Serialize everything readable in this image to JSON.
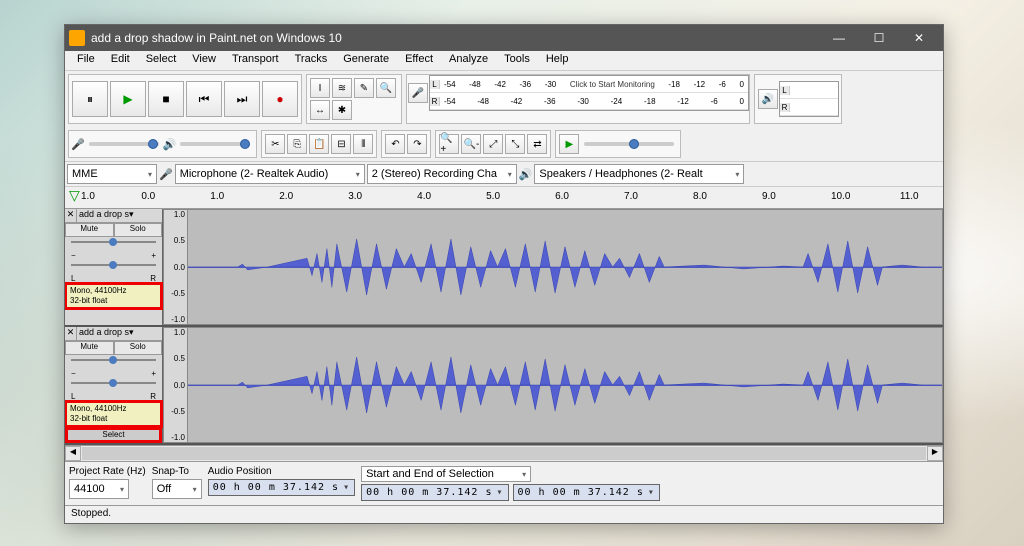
{
  "window": {
    "title": "add a drop shadow in Paint.net on Windows 10"
  },
  "menu": [
    "File",
    "Edit",
    "Select",
    "View",
    "Transport",
    "Tracks",
    "Generate",
    "Effect",
    "Analyze",
    "Tools",
    "Help"
  ],
  "meters": {
    "monitor_text": "Click to Start Monitoring",
    "scale": [
      "-54",
      "-48",
      "-42",
      "-36",
      "-30",
      "-24",
      "-18",
      "-12",
      "-6",
      "0"
    ]
  },
  "devices": {
    "host": "MME",
    "input": "Microphone (2- Realtek Audio)",
    "channels": "2 (Stereo) Recording Cha",
    "output": "Speakers / Headphones (2- Realt"
  },
  "timeline": {
    "ticks": [
      "1.0",
      "0.0",
      "1.0",
      "2.0",
      "3.0",
      "4.0",
      "5.0",
      "6.0",
      "7.0",
      "8.0",
      "9.0",
      "10.0",
      "11.0"
    ]
  },
  "track": {
    "name": "add a drop s",
    "mute": "Mute",
    "solo": "Solo",
    "left": "L",
    "right": "R",
    "info1": "Mono, 44100Hz",
    "info2": "32-bit float",
    "select": "Select",
    "scale": [
      "1.0",
      "0.5",
      "0.0",
      "-0.5",
      "-1.0"
    ]
  },
  "bottom": {
    "rate_label": "Project Rate (Hz)",
    "rate_value": "44100",
    "snap_label": "Snap-To",
    "snap_value": "Off",
    "audiopos_label": "Audio Position",
    "sel_label": "Start and End of Selection",
    "time_value": "00 h 00 m 37.142 s"
  },
  "status": "Stopped."
}
